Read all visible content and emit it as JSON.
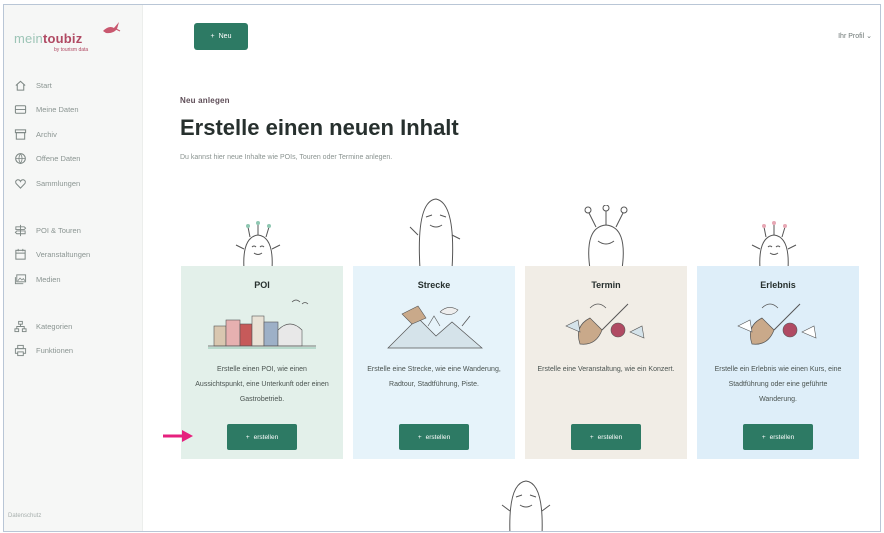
{
  "brand": {
    "name_prefix": "mein",
    "name_main": "toubiz",
    "tagline": "by tourism data"
  },
  "sidebar": {
    "group1": [
      {
        "label": "Start",
        "icon": "home-icon"
      },
      {
        "label": "Meine Daten",
        "icon": "database-icon"
      },
      {
        "label": "Archiv",
        "icon": "archive-icon"
      },
      {
        "label": "Offene Daten",
        "icon": "globe-icon"
      },
      {
        "label": "Sammlungen",
        "icon": "heart-icon"
      }
    ],
    "group2": [
      {
        "label": "POI & Touren",
        "icon": "signpost-icon"
      },
      {
        "label": "Veranstaltungen",
        "icon": "calendar-icon"
      },
      {
        "label": "Medien",
        "icon": "images-icon"
      }
    ],
    "group3": [
      {
        "label": "Kategorien",
        "icon": "hierarchy-icon"
      },
      {
        "label": "Funktionen",
        "icon": "printer-icon"
      }
    ],
    "footer": "Datenschutz"
  },
  "header": {
    "new_button": "Neu",
    "profile_label": "Ihr Profil"
  },
  "main": {
    "subtitle": "Neu anlegen",
    "title": "Erstelle einen neuen Inhalt",
    "description": "Du kannst hier neue Inhalte wie POIs, Touren oder Termine anlegen."
  },
  "cards": [
    {
      "title": "POI",
      "text": "Erstelle einen POI, wie einen Aussichtspunkt, eine Unterkunft oder einen Gastrobetrieb.",
      "button": "erstellen",
      "bg": "#e3f0ea"
    },
    {
      "title": "Strecke",
      "text": "Erstelle eine Strecke, wie eine Wanderung, Radtour, Stadtführung, Piste.",
      "button": "erstellen",
      "bg": "#e6f3fa"
    },
    {
      "title": "Termin",
      "text": "Erstelle eine Veranstaltung, wie ein Konzert.",
      "button": "erstellen",
      "bg": "#f1ede6"
    },
    {
      "title": "Erlebnis",
      "text": "Erstelle ein Erlebnis wie einen Kurs, eine Stadtführung oder eine geführte Wanderung.",
      "button": "erstellen",
      "bg": "#deeef9"
    }
  ],
  "colors": {
    "primary": "#2d7a64",
    "accent_arrow": "#e6207e",
    "brand_pink": "#b04a63"
  }
}
